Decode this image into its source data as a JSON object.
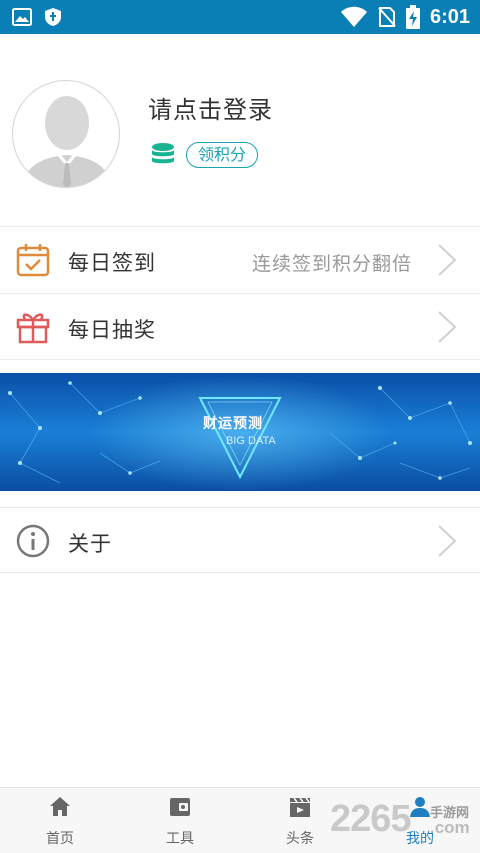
{
  "status_bar": {
    "time": "6:01",
    "icons": [
      "image-icon",
      "shield-icon",
      "wifi-icon",
      "no-sim-icon",
      "battery-charging-icon"
    ]
  },
  "profile": {
    "login_prompt": "请点击登录",
    "points_badge": "领积分",
    "icons": [
      "default-avatar-icon",
      "coins-stack-icon"
    ],
    "accent_color": "#1aa3b8"
  },
  "menu": {
    "items": [
      {
        "label": "每日签到",
        "hint": "连续签到积分翻倍",
        "icon": "calendar-check-icon",
        "icon_color": "#e08a3c"
      },
      {
        "label": "每日抽奖",
        "hint": "",
        "icon": "gift-icon",
        "icon_color": "#e05a5a"
      }
    ],
    "about": {
      "label": "关于",
      "icon": "info-icon"
    }
  },
  "banner": {
    "title": "财运预测",
    "subtitle": "BIG DATA"
  },
  "bottom_nav": {
    "tabs": [
      {
        "label": "首页",
        "icon": "home-icon",
        "active": false
      },
      {
        "label": "工具",
        "icon": "wallet-icon",
        "active": false
      },
      {
        "label": "头条",
        "icon": "clapper-icon",
        "active": false
      },
      {
        "label": "我的",
        "icon": "user-icon",
        "active": true
      }
    ],
    "active_color": "#1f7fc0"
  },
  "watermark": {
    "digits": "2265",
    "text_cn": "手游网",
    "text_en": ".com"
  }
}
